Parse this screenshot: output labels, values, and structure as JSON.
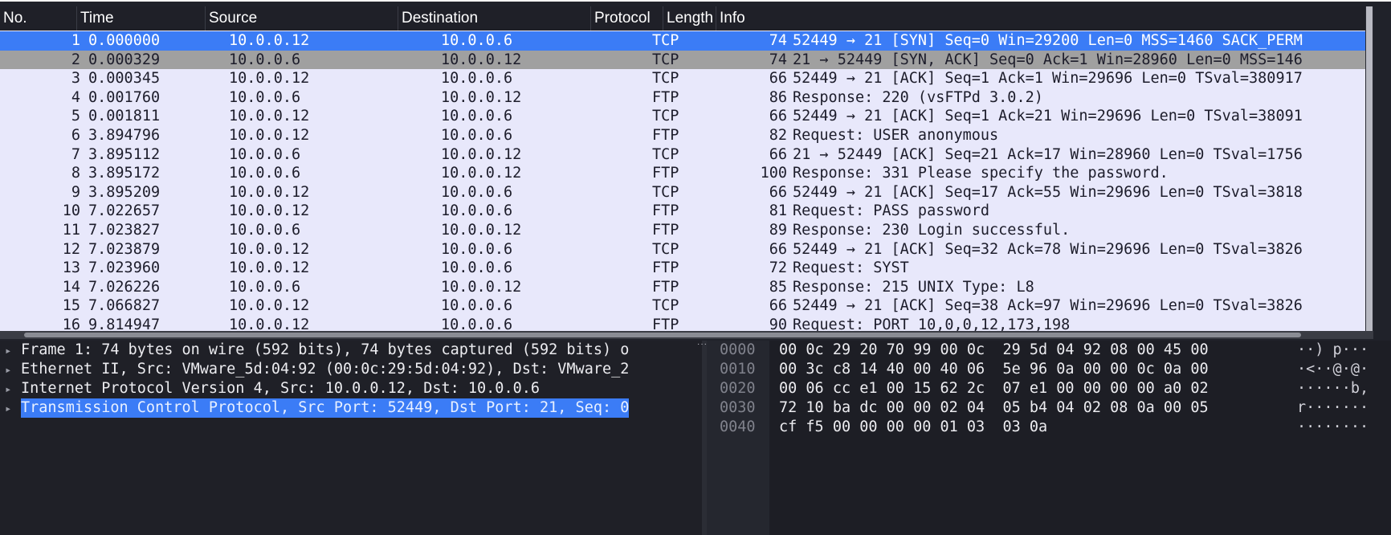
{
  "columns": {
    "no": "No.",
    "time": "Time",
    "source": "Source",
    "destination": "Destination",
    "protocol": "Protocol",
    "length": "Length",
    "info": "Info"
  },
  "packets": [
    {
      "no": "1",
      "time": "0.000000",
      "source": "10.0.0.12",
      "destination": "10.0.0.6",
      "protocol": "TCP",
      "length": "74",
      "info": "52449 → 21 [SYN] Seq=0 Win=29200 Len=0 MSS=1460 SACK_PERM"
    },
    {
      "no": "2",
      "time": "0.000329",
      "source": "10.0.0.6",
      "destination": "10.0.0.12",
      "protocol": "TCP",
      "length": "74",
      "info": "21 → 52449 [SYN, ACK] Seq=0 Ack=1 Win=28960 Len=0 MSS=146"
    },
    {
      "no": "3",
      "time": "0.000345",
      "source": "10.0.0.12",
      "destination": "10.0.0.6",
      "protocol": "TCP",
      "length": "66",
      "info": "52449 → 21 [ACK] Seq=1 Ack=1 Win=29696 Len=0 TSval=380917"
    },
    {
      "no": "4",
      "time": "0.001760",
      "source": "10.0.0.6",
      "destination": "10.0.0.12",
      "protocol": "FTP",
      "length": "86",
      "info": "Response: 220 (vsFTPd 3.0.2)"
    },
    {
      "no": "5",
      "time": "0.001811",
      "source": "10.0.0.12",
      "destination": "10.0.0.6",
      "protocol": "TCP",
      "length": "66",
      "info": "52449 → 21 [ACK] Seq=1 Ack=21 Win=29696 Len=0 TSval=38091"
    },
    {
      "no": "6",
      "time": "3.894796",
      "source": "10.0.0.12",
      "destination": "10.0.0.6",
      "protocol": "FTP",
      "length": "82",
      "info": "Request: USER anonymous"
    },
    {
      "no": "7",
      "time": "3.895112",
      "source": "10.0.0.6",
      "destination": "10.0.0.12",
      "protocol": "TCP",
      "length": "66",
      "info": "21 → 52449 [ACK] Seq=21 Ack=17 Win=28960 Len=0 TSval=1756"
    },
    {
      "no": "8",
      "time": "3.895172",
      "source": "10.0.0.6",
      "destination": "10.0.0.12",
      "protocol": "FTP",
      "length": "100",
      "info": "Response: 331 Please specify the password."
    },
    {
      "no": "9",
      "time": "3.895209",
      "source": "10.0.0.12",
      "destination": "10.0.0.6",
      "protocol": "TCP",
      "length": "66",
      "info": "52449 → 21 [ACK] Seq=17 Ack=55 Win=29696 Len=0 TSval=3818"
    },
    {
      "no": "10",
      "time": "7.022657",
      "source": "10.0.0.12",
      "destination": "10.0.0.6",
      "protocol": "FTP",
      "length": "81",
      "info": "Request: PASS password"
    },
    {
      "no": "11",
      "time": "7.023827",
      "source": "10.0.0.6",
      "destination": "10.0.0.12",
      "protocol": "FTP",
      "length": "89",
      "info": "Response: 230 Login successful."
    },
    {
      "no": "12",
      "time": "7.023879",
      "source": "10.0.0.12",
      "destination": "10.0.0.6",
      "protocol": "TCP",
      "length": "66",
      "info": "52449 → 21 [ACK] Seq=32 Ack=78 Win=29696 Len=0 TSval=3826"
    },
    {
      "no": "13",
      "time": "7.023960",
      "source": "10.0.0.12",
      "destination": "10.0.0.6",
      "protocol": "FTP",
      "length": "72",
      "info": "Request: SYST"
    },
    {
      "no": "14",
      "time": "7.026226",
      "source": "10.0.0.6",
      "destination": "10.0.0.12",
      "protocol": "FTP",
      "length": "85",
      "info": "Response: 215 UNIX Type: L8"
    },
    {
      "no": "15",
      "time": "7.066827",
      "source": "10.0.0.12",
      "destination": "10.0.0.6",
      "protocol": "TCP",
      "length": "66",
      "info": "52449 → 21 [ACK] Seq=38 Ack=97 Win=29696 Len=0 TSval=3826"
    },
    {
      "no": "16",
      "time": "9.814947",
      "source": "10.0.0.12",
      "destination": "10.0.0.6",
      "protocol": "FTP",
      "length": "90",
      "info": "Request: PORT 10,0,0,12,173,198"
    }
  ],
  "details": [
    "Frame 1: 74 bytes on wire (592 bits), 74 bytes captured (592 bits) o",
    "Ethernet II, Src: VMware_5d:04:92 (00:0c:29:5d:04:92), Dst: VMware_2",
    "Internet Protocol Version 4, Src: 10.0.0.12, Dst: 10.0.0.6",
    "Transmission Control Protocol, Src Port: 52449, Dst Port: 21, Seq: 0"
  ],
  "bytes": {
    "offsets": [
      "0000",
      "0010",
      "0020",
      "0030",
      "0040"
    ],
    "hex": [
      "00 0c 29 20 70 99 00 0c  29 5d 04 92 08 00 45 00",
      "00 3c c8 14 40 00 40 06  5e 96 0a 00 00 0c 0a 00",
      "00 06 cc e1 00 15 62 2c  07 e1 00 00 00 00 a0 02",
      "72 10 ba dc 00 00 02 04  05 b4 04 02 08 0a 00 05",
      "cf f5 00 00 00 00 01 03  03 0a"
    ],
    "ascii": [
      "··) p···",
      "·<··@·@·",
      "······b,",
      "r·······",
      "········"
    ]
  },
  "colors": {
    "list_bg": "#e8e8fb",
    "selected": "#3b7cf6",
    "related": "#a0a0a0",
    "dark_bg": "#1f2027"
  }
}
